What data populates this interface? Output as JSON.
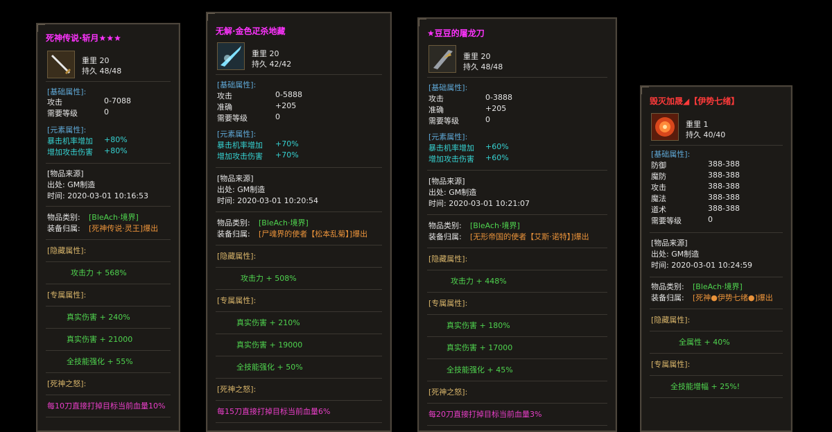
{
  "panels": [
    {
      "title": "死神传说·斩月★★★",
      "title_color": "#ff33ff",
      "icon": "sword-icon",
      "weight": "重里 20",
      "durability": "持久 48/48",
      "base_header": "[基础属性]:",
      "base": [
        {
          "k": "攻击",
          "v": "0-7088"
        },
        {
          "k": "需要等级",
          "v": "0"
        }
      ],
      "elem_header": "[元素属性]:",
      "elem": [
        {
          "k": "暴击机率增加",
          "v": "+80%"
        },
        {
          "k": "增加攻击伤害",
          "v": "+80%"
        }
      ],
      "source_header": "[物品来源]",
      "source": "出处: GM制造",
      "time": "时间: 2020-03-01 10:16:53",
      "category_label": "物品类别:",
      "category": "[BleAch·境界]",
      "owner_label": "装备归属:",
      "owner": "[死神传说·灵王]爆出",
      "hidden_header": "[隐藏属性]:",
      "hidden": [
        "攻击力 + 568%"
      ],
      "exclusive_header": "[专属属性]:",
      "exclusive": [
        "真实伤害 + 240%",
        "真实伤害 + 21000",
        "全技能强化 + 55%"
      ],
      "wrath_header": "[死神之怒]:",
      "wrath": "每10刀直接打掉目标当前血量10%"
    },
    {
      "title": "无解·金色疋杀地藏",
      "title_color": "#ff33ff",
      "icon": "spear-icon",
      "weight": "重里 20",
      "durability": "持久 42/42",
      "base_header": "[基础属性]:",
      "base": [
        {
          "k": "攻击",
          "v": "0-5888"
        },
        {
          "k": "准确",
          "v": "+205"
        },
        {
          "k": "需要等级",
          "v": "0"
        }
      ],
      "elem_header": "[元素属性]:",
      "elem": [
        {
          "k": "暴击机率增加",
          "v": "+70%"
        },
        {
          "k": "增加攻击伤害",
          "v": "+70%"
        }
      ],
      "source_header": "[物品来源]",
      "source": "出处: GM制造",
      "time": "时间: 2020-03-01 10:20:54",
      "category_label": "物品类别:",
      "category": "[BleAch·境界]",
      "owner_label": "装备归属:",
      "owner": "[尸魂界的使者【松本乱菊】]爆出",
      "hidden_header": "[隐藏属性]:",
      "hidden": [
        "攻击力 + 508%"
      ],
      "exclusive_header": "[专属属性]:",
      "exclusive": [
        "真实伤害 + 210%",
        "真实伤害 + 19000",
        "全技能强化 + 50%"
      ],
      "wrath_header": "[死神之怒]:",
      "wrath": "每15刀直接打掉目标当前血量6%"
    },
    {
      "title": "★豆豆的屠龙刀",
      "title_color": "#ff33ff",
      "icon": "blade-icon",
      "weight": "重里 20",
      "durability": "持久 48/48",
      "base_header": "[基础属性]:",
      "base": [
        {
          "k": "攻击",
          "v": "0-3888"
        },
        {
          "k": "准确",
          "v": "+205"
        },
        {
          "k": "需要等级",
          "v": "0"
        }
      ],
      "elem_header": "[元素属性]:",
      "elem": [
        {
          "k": "暴击机率增加",
          "v": "+60%"
        },
        {
          "k": "增加攻击伤害",
          "v": "+60%"
        }
      ],
      "source_header": "[物品来源]",
      "source": "出处: GM制造",
      "time": "时间: 2020-03-01 10:21:07",
      "category_label": "物品类别:",
      "category": "[BleAch·境界]",
      "owner_label": "装备归属:",
      "owner": "[无形帝国的使者【艾斯·诺特】]爆出",
      "hidden_header": "[隐藏属性]:",
      "hidden": [
        "攻击力 + 448%"
      ],
      "exclusive_header": "[专属属性]:",
      "exclusive": [
        "真实伤害 + 180%",
        "真实伤害 + 17000",
        "全技能强化 + 45%"
      ],
      "wrath_header": "[死神之怒]:",
      "wrath": "每20刀直接打掉目标当前血量3%"
    },
    {
      "title": "毁灭加晟◢【伊势七绪】",
      "title_color": "#ff3a3a",
      "icon": "emblem-icon",
      "weight": "重里 1",
      "durability": "持久 40/40",
      "base_header": "[基础属性]:",
      "base": [
        {
          "k": "防御",
          "v": "388-388"
        },
        {
          "k": "魔防",
          "v": "388-388"
        },
        {
          "k": "攻击",
          "v": "388-388"
        },
        {
          "k": "魔法",
          "v": "388-388"
        },
        {
          "k": "道术",
          "v": "388-388"
        },
        {
          "k": "需要等级",
          "v": "0"
        }
      ],
      "source_header": "[物品来源]",
      "source": "出处: GM制造",
      "time": "时间: 2020-03-01 10:24:59",
      "category_label": "物品类别:",
      "category": "[BleAch·境界]",
      "owner_label": "装备归属:",
      "owner": "[死神●伊势七绪●]爆出",
      "hidden_header": "[隐藏属性]:",
      "hidden": [
        "全属性 + 40%"
      ],
      "exclusive_header": "[专属属性]:",
      "exclusive": [
        "全技能增幅 + 25%!"
      ]
    }
  ]
}
